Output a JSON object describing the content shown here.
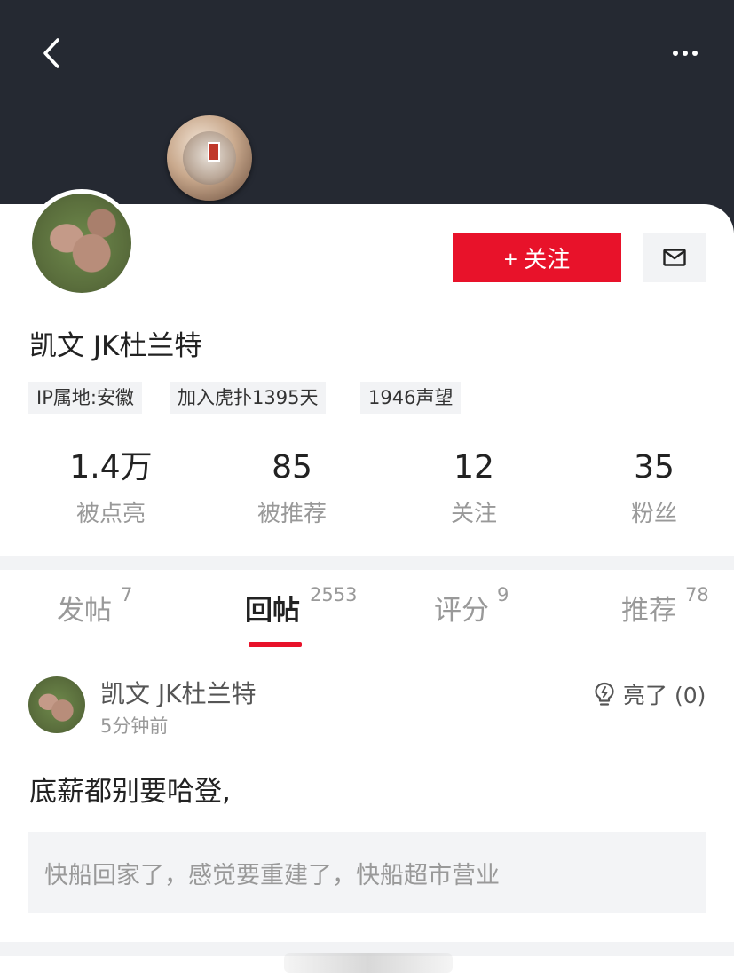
{
  "header": {
    "back_icon": "chevron-left-icon",
    "more_icon": "more-horizontal-icon",
    "badge_icon": "achievement-medal-icon"
  },
  "profile": {
    "username": "凯文 JK杜兰特",
    "follow_label": "+ 关注",
    "message_icon": "mail-icon",
    "tags": [
      "IP属地:安徽",
      "加入虎扑1395天",
      "1946声望"
    ],
    "stats": [
      {
        "value": "1.4万",
        "label": "被点亮"
      },
      {
        "value": "85",
        "label": "被推荐"
      },
      {
        "value": "12",
        "label": "关注"
      },
      {
        "value": "35",
        "label": "粉丝"
      }
    ]
  },
  "tabs": [
    {
      "label": "发帖",
      "count": "7"
    },
    {
      "label": "回帖",
      "count": "2553",
      "active": true
    },
    {
      "label": "评分",
      "count": "9"
    },
    {
      "label": "推荐",
      "count": "78"
    }
  ],
  "post": {
    "author": "凯文 JK杜兰特",
    "time": "5分钟前",
    "light_label": "亮了 (0)",
    "light_icon": "lightbulb-icon",
    "body": "底薪都别要哈登,",
    "quote": "快船回家了，感觉要重建了，快船超市营业"
  },
  "colors": {
    "accent": "#e8122a",
    "header_bg": "#252932"
  }
}
